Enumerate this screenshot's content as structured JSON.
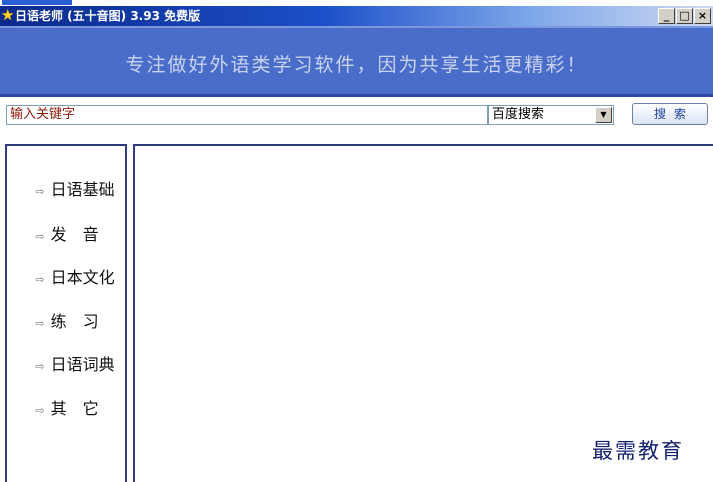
{
  "window": {
    "title": "日语老师 (五十音图) 3.93 免费版",
    "buttons": [
      "_",
      "□",
      "×"
    ]
  },
  "banner": {
    "slogan": "专注做好外语类学习软件，因为共享生活更精彩！"
  },
  "search": {
    "keyword_value": "输入关键字",
    "engine_selected": "百度搜索",
    "button_label": "搜索"
  },
  "sidebar": {
    "items": [
      {
        "label": "日语基础"
      },
      {
        "label": "发　音"
      },
      {
        "label": "日本文化"
      },
      {
        "label": "练　习"
      },
      {
        "label": "日语词典"
      },
      {
        "label": "其　它"
      }
    ]
  },
  "watermark": "最需教育",
  "colors": {
    "titlebar": "#0a2a8c",
    "banner": "#4a6dc9",
    "border": "#2e3d7a"
  }
}
